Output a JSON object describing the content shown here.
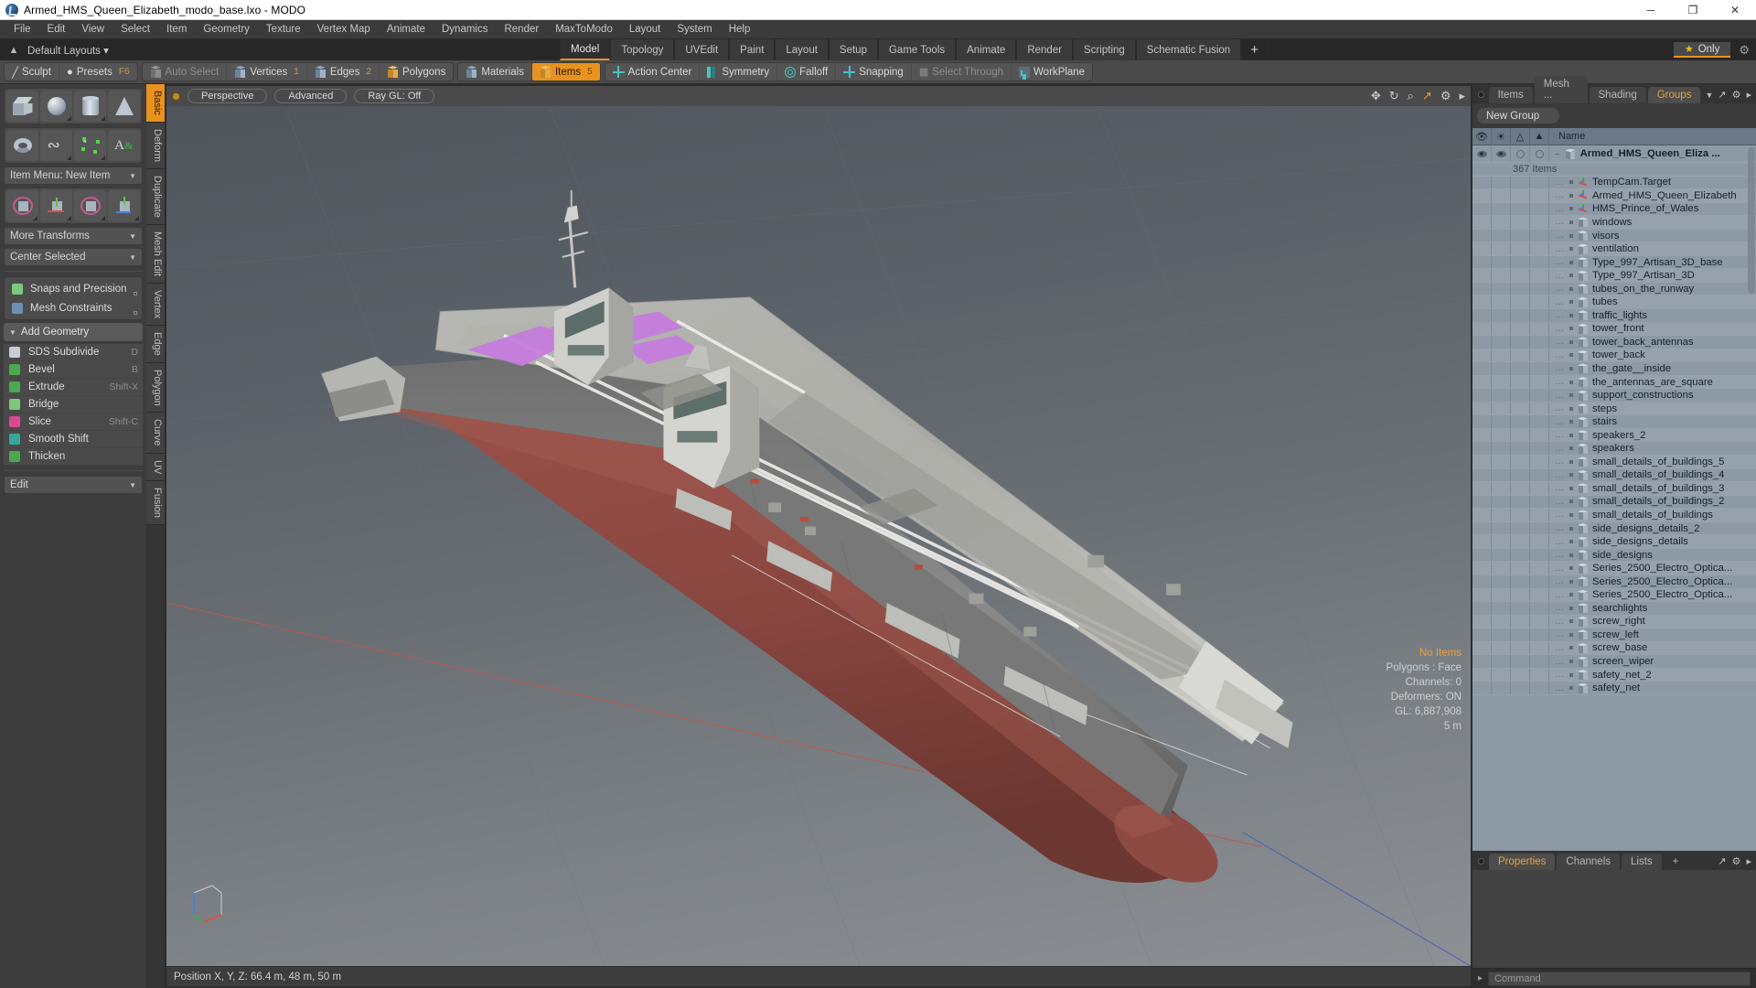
{
  "window": {
    "title": "Armed_HMS_Queen_Elizabeth_modo_base.lxo - MODO",
    "app_icon": "modo-logo-icon",
    "controls": {
      "minimize": "─",
      "maximize": "❐",
      "close": "✕"
    }
  },
  "menubar": [
    "File",
    "Edit",
    "View",
    "Select",
    "Item",
    "Geometry",
    "Texture",
    "Vertex Map",
    "Animate",
    "Dynamics",
    "Render",
    "MaxToModo",
    "Layout",
    "System",
    "Help"
  ],
  "layoutbar": {
    "home_icon": "home-icon",
    "layout_dropdown": "Default Layouts",
    "tabs": [
      "Model",
      "Topology",
      "UVEdit",
      "Paint",
      "Layout",
      "Setup",
      "Game Tools",
      "Animate",
      "Render",
      "Scripting",
      "Schematic Fusion"
    ],
    "active_tab": "Model",
    "add_tab": "+",
    "only_button": "Only",
    "star_icon": "star-icon",
    "gear_icon": "gear-icon"
  },
  "toolbar": {
    "group1": [
      {
        "label": "Sculpt",
        "icon": "sculpt-icon",
        "shortcut": "",
        "state": "normal"
      },
      {
        "label": "Presets",
        "icon": "presets-icon",
        "shortcut": "F6",
        "state": "normal"
      }
    ],
    "group2": [
      {
        "label": "Auto Select",
        "icon": "cube-gray-icon",
        "num": "",
        "state": "dim"
      },
      {
        "label": "Vertices",
        "icon": "cube-icon",
        "num": "1",
        "state": "normal"
      },
      {
        "label": "Edges",
        "icon": "cube-icon",
        "num": "2",
        "state": "normal"
      },
      {
        "label": "Polygons",
        "icon": "cube-orange-icon",
        "num": "",
        "state": "normal"
      }
    ],
    "group3": [
      {
        "label": "Materials",
        "icon": "cube-icon",
        "num": "",
        "state": "normal"
      },
      {
        "label": "Items",
        "icon": "cube-orange-icon",
        "num": "5",
        "state": "selected"
      }
    ],
    "group4": [
      {
        "label": "Action Center",
        "icon": "crosshair-icon",
        "state": "normal"
      },
      {
        "label": "Symmetry",
        "icon": "symmetry-icon",
        "state": "normal"
      },
      {
        "label": "Falloff",
        "icon": "falloff-icon",
        "state": "normal"
      },
      {
        "label": "Snapping",
        "icon": "snapping-icon",
        "state": "normal"
      },
      {
        "label": "Select Through",
        "icon": "select-through-icon",
        "state": "dim"
      },
      {
        "label": "WorkPlane",
        "icon": "workplane-icon",
        "state": "normal"
      }
    ]
  },
  "left_palette": {
    "primitive_row1": [
      {
        "name": "cube-tool",
        "icon": "cube-shape-icon"
      },
      {
        "name": "sphere-tool",
        "icon": "sphere-shape-icon"
      },
      {
        "name": "cylinder-tool",
        "icon": "cylinder-shape-icon"
      },
      {
        "name": "cone-tool",
        "icon": "cone-shape-icon"
      }
    ],
    "primitive_row2": [
      {
        "name": "torus-tool",
        "icon": "torus-shape-icon"
      },
      {
        "name": "curve-tool",
        "icon": "curve-shape-icon"
      },
      {
        "name": "polygon-tool",
        "icon": "polygon-shape-icon"
      },
      {
        "name": "text-tool",
        "icon": "text-shape-icon"
      }
    ],
    "item_menu": "Item Menu: New Item",
    "transform_row": [
      {
        "name": "transform-tool",
        "icon": "transform-gizmo-icon"
      },
      {
        "name": "move-tool",
        "icon": "move-gizmo-icon"
      },
      {
        "name": "rotate-tool",
        "icon": "rotate-gizmo-icon"
      },
      {
        "name": "scale-tool",
        "icon": "scale-gizmo-icon"
      }
    ],
    "more_transforms": "More Transforms",
    "center_selected": "Center Selected",
    "snaps_and_precision": "Snaps and Precision",
    "mesh_constraints": "Mesh Constraints",
    "add_geometry_header": "Add Geometry",
    "geometry_items": [
      {
        "label": "SDS Subdivide",
        "shortcut": "D"
      },
      {
        "label": "Bevel",
        "shortcut": "B"
      },
      {
        "label": "Extrude",
        "shortcut": "Shift-X"
      },
      {
        "label": "Bridge",
        "shortcut": ""
      },
      {
        "label": "Slice",
        "shortcut": "Shift-C"
      },
      {
        "label": "Smooth Shift",
        "shortcut": ""
      },
      {
        "label": "Thicken",
        "shortcut": ""
      }
    ],
    "edit_dropdown": "Edit",
    "vertical_tabs": [
      "Basic",
      "Deform",
      "Duplicate",
      "Mesh Edit",
      "Vertex",
      "Edge",
      "Polygon",
      "Curve",
      "UV",
      "Fusion"
    ],
    "active_vertical_tab": "Basic"
  },
  "viewport": {
    "dot_icon": "viewport-state-icon",
    "pills": [
      "Perspective",
      "Advanced",
      "Ray GL: Off"
    ],
    "right_icons": [
      "move-icon",
      "rotate-icon",
      "zoom-icon",
      "fit-icon",
      "gear-icon",
      "caret-icon"
    ],
    "overlay": {
      "no_items": "No Items",
      "polygons": "Polygons : Face",
      "channels": "Channels: 0",
      "deformers": "Deformers: ON",
      "gl": "GL: 6,887,908",
      "scale": "5 m"
    },
    "statusbar": "Position X, Y, Z:   66.4 m, 48 m, 50 m"
  },
  "right_panel": {
    "tabs": [
      "Items",
      "Mesh ...",
      "Shading",
      "Groups"
    ],
    "active_tab": "Groups",
    "caret_icon": "chevron-down-icon",
    "expand_icon": "expand-icon",
    "gear_icon": "gear-icon",
    "arrow_icon": "caret-right-icon",
    "new_group_button": "New Group",
    "tree_headers": {
      "visible": "eye-icon",
      "render": "render-icon",
      "lock": "lock-icon",
      "select": "select-icon",
      "name": "Name"
    },
    "root_item": "Armed_HMS_Queen_Eliza ...",
    "root_count": "367 Items",
    "items": [
      {
        "label": "TempCam.Target",
        "icon": "locator-icon"
      },
      {
        "label": "Armed_HMS_Queen_Elizabeth",
        "icon": "locator-icon"
      },
      {
        "label": "HMS_Prince_of_Wales",
        "icon": "locator-icon"
      },
      {
        "label": "windows",
        "icon": "mesh-icon"
      },
      {
        "label": "visors",
        "icon": "mesh-icon"
      },
      {
        "label": "ventilation",
        "icon": "mesh-icon"
      },
      {
        "label": "Type_997_Artisan_3D_base",
        "icon": "mesh-icon"
      },
      {
        "label": "Type_997_Artisan_3D",
        "icon": "mesh-icon"
      },
      {
        "label": "tubes_on_the_runway",
        "icon": "mesh-icon"
      },
      {
        "label": "tubes",
        "icon": "mesh-icon"
      },
      {
        "label": "traffic_lights",
        "icon": "mesh-icon"
      },
      {
        "label": "tower_front",
        "icon": "mesh-icon"
      },
      {
        "label": "tower_back_antennas",
        "icon": "mesh-icon"
      },
      {
        "label": "tower_back",
        "icon": "mesh-icon"
      },
      {
        "label": "the_gate__inside",
        "icon": "mesh-icon"
      },
      {
        "label": "the_antennas_are_square",
        "icon": "mesh-icon"
      },
      {
        "label": "support_constructions",
        "icon": "mesh-icon"
      },
      {
        "label": "steps",
        "icon": "mesh-icon"
      },
      {
        "label": "stairs",
        "icon": "mesh-icon"
      },
      {
        "label": "speakers_2",
        "icon": "mesh-icon"
      },
      {
        "label": "speakers",
        "icon": "mesh-icon"
      },
      {
        "label": "small_details_of_buildings_5",
        "icon": "mesh-icon"
      },
      {
        "label": "small_details_of_buildings_4",
        "icon": "mesh-icon"
      },
      {
        "label": "small_details_of_buildings_3",
        "icon": "mesh-icon"
      },
      {
        "label": "small_details_of_buildings_2",
        "icon": "mesh-icon"
      },
      {
        "label": "small_details_of_buildings",
        "icon": "mesh-icon"
      },
      {
        "label": "side_designs_details_2",
        "icon": "mesh-icon"
      },
      {
        "label": "side_designs_details",
        "icon": "mesh-icon"
      },
      {
        "label": "side_designs",
        "icon": "mesh-icon"
      },
      {
        "label": "Series_2500_Electro_Optica...",
        "icon": "mesh-icon"
      },
      {
        "label": "Series_2500_Electro_Optica...",
        "icon": "mesh-icon"
      },
      {
        "label": "Series_2500_Electro_Optica...",
        "icon": "mesh-icon"
      },
      {
        "label": "searchlights",
        "icon": "mesh-icon"
      },
      {
        "label": "screw_right",
        "icon": "mesh-icon"
      },
      {
        "label": "screw_left",
        "icon": "mesh-icon"
      },
      {
        "label": "screw_base",
        "icon": "mesh-icon"
      },
      {
        "label": "screen_wiper",
        "icon": "mesh-icon"
      },
      {
        "label": "safety_net_2",
        "icon": "mesh-icon"
      },
      {
        "label": "safety_net",
        "icon": "mesh-icon"
      }
    ],
    "bottom_tabs": [
      "Properties",
      "Channels",
      "Lists"
    ],
    "bottom_active_tab": "Properties",
    "bottom_add_tab": "+",
    "command_placeholder": "Command",
    "command_caret": "caret-right-icon"
  },
  "colors": {
    "accent_orange": "#e8921f",
    "teal": "#46c3c3",
    "tree_bg": "#8d99a5",
    "hull_red": "#8e4a44",
    "panel_gray": "#3a3a3a"
  }
}
